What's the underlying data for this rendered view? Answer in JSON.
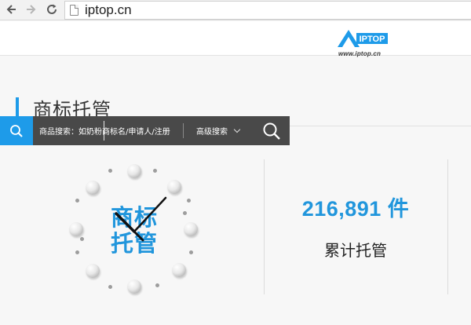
{
  "browser": {
    "url": "iptop.cn"
  },
  "header": {
    "logo_text": "IPTOP",
    "logo_url": "www.iptop.cn"
  },
  "section": {
    "title": "商标托管"
  },
  "search": {
    "placeholder": "商品搜索：如奶粉商标名/申请人/注册",
    "advanced_label": "高级搜索"
  },
  "clock": {
    "text_line1": "商标",
    "text_line2": "托管"
  },
  "stats": {
    "count": "216,891 件",
    "label": "累计托管"
  },
  "colors": {
    "accent": "#1e9be9",
    "text_blue": "#2196dc",
    "search_bg": "#494949"
  }
}
